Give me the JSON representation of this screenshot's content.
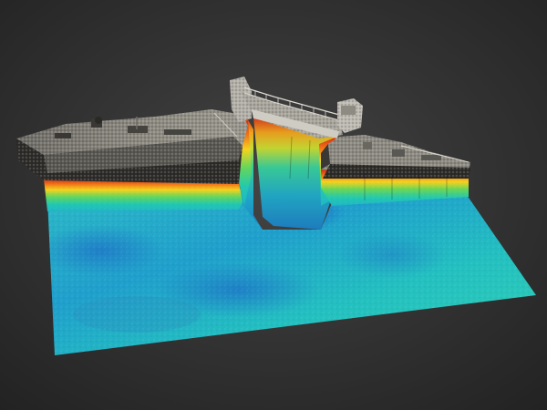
{
  "scene": {
    "subject": "3d-point-cloud-render",
    "colors": {
      "background_top": "#3c3c3c",
      "background_bottom": "#262626",
      "deep": "#1f6fc4",
      "shallow": "#1ec6c0",
      "mid": "#38d48a",
      "warm": "#f2c81c",
      "hot": "#e83a1a",
      "structure_light": "#b9b6ae",
      "structure_dark": "#2b2a28"
    }
  }
}
